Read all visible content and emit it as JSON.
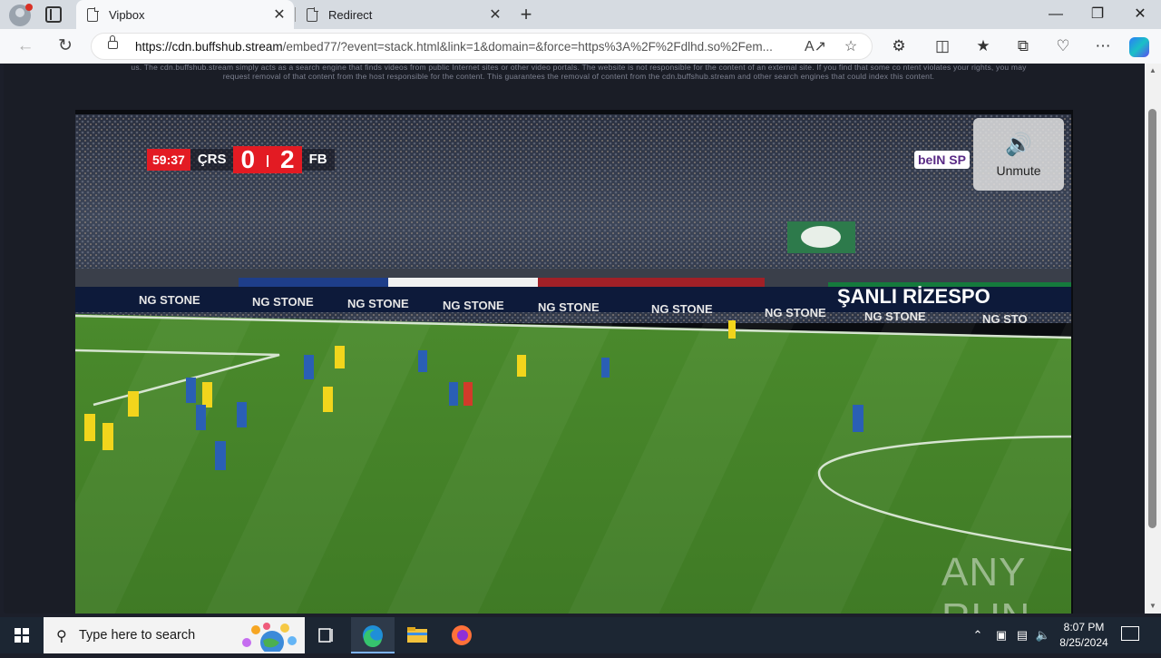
{
  "browser": {
    "tabs": [
      {
        "title": "Vipbox",
        "active": true
      },
      {
        "title": "Redirect",
        "active": false
      }
    ],
    "url_host": "https://cdn.buffshub.stream",
    "url_rest": "/embed77/?event=stack.html&link=1&domain=&force=https%3A%2F%2Fdlhd.so%2Fem..."
  },
  "page": {
    "disclaimer": "us. The cdn.buffshub.stream simply acts as a search engine that finds videos from public Internet sites or other video portals. The website is not responsible for the content of an external site. If you find that some co ntent violates your rights, you may request removal of that content from the host responsible for the content. This guarantees the removal of content from the cdn.buffshub.stream and other search engines that could index this content."
  },
  "player": {
    "unmute_label": "Unmute",
    "scoreboard": {
      "time": "59:37",
      "home": "ÇRS",
      "home_score": "0",
      "away_score": "2",
      "away": "FB"
    },
    "broadcaster": "beIN SP",
    "watermark": "ANY RUN"
  },
  "taskbar": {
    "search_placeholder": "Type here to search",
    "time": "8:07 PM",
    "date": "8/25/2024"
  },
  "colors": {
    "accent": "#e31b23",
    "taskbar": "#1c2633",
    "page_bg": "#1c1f2a"
  }
}
